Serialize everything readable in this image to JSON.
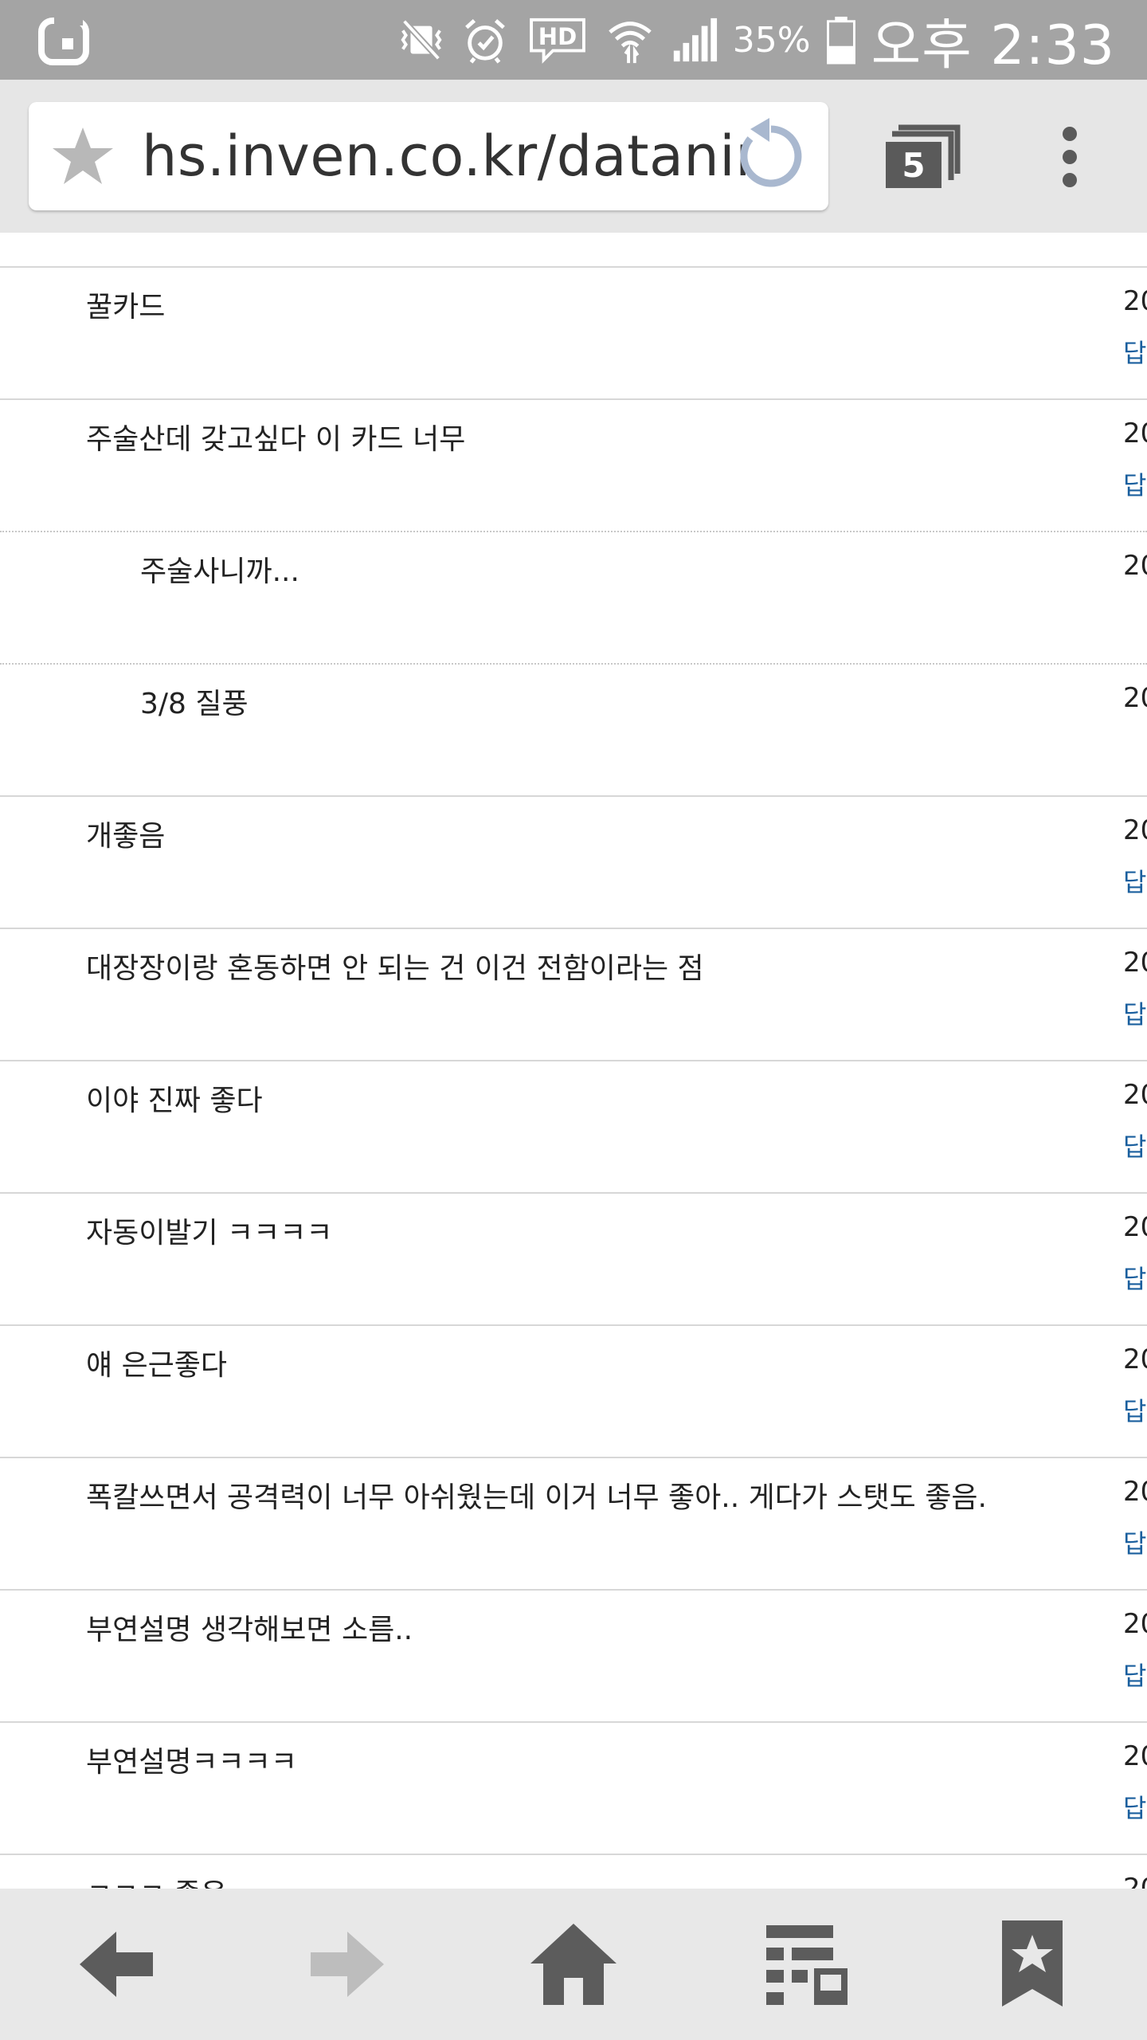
{
  "status_bar": {
    "icons": [
      "carrier-logo-icon",
      "vibrate-off-icon",
      "alarm-icon",
      "hd-voice-icon",
      "wifi-icon",
      "signal-icon",
      "battery-icon"
    ],
    "hd_label": "HD",
    "battery_percent": "35%",
    "time": "오후 2:33"
  },
  "toolbar": {
    "url": "hs.inven.co.kr/dataninfo",
    "tab_count": "5"
  },
  "list": [
    {
      "title": "꿀카드",
      "date": "20",
      "reply": "답",
      "indent": false,
      "sep": "solid"
    },
    {
      "title": "주술산데 갖고싶다 이 카드 너무",
      "date": "20",
      "reply": "답",
      "indent": false,
      "sep": "solid"
    },
    {
      "title": "주술사니까...",
      "date": "20",
      "reply": "",
      "indent": true,
      "sep": "dotted"
    },
    {
      "title": "3/8 질풍",
      "date": "20",
      "reply": "",
      "indent": true,
      "sep": "dotted"
    },
    {
      "title": "개좋음",
      "date": "20",
      "reply": "답",
      "indent": false,
      "sep": "solid"
    },
    {
      "title": "대장장이랑 혼동하면 안 되는 건 이건 전함이라는 점",
      "date": "20",
      "reply": "답",
      "indent": false,
      "sep": "solid"
    },
    {
      "title": "이야 진짜 좋다",
      "date": "20",
      "reply": "답",
      "indent": false,
      "sep": "solid"
    },
    {
      "title": "자동이발기 ㅋㅋㅋㅋ",
      "date": "20",
      "reply": "답",
      "indent": false,
      "sep": "solid"
    },
    {
      "title": "얘 은근좋다",
      "date": "20",
      "reply": "답",
      "indent": false,
      "sep": "solid"
    },
    {
      "title": "폭칼쓰면서 공격력이 너무 아쉬웠는데 이거 너무 좋아.. 게다가 스탯도 좋음.",
      "date": "20",
      "reply": "답",
      "indent": false,
      "sep": "solid"
    },
    {
      "title": "부연설명 생각해보면 소름..",
      "date": "20",
      "reply": "답",
      "indent": false,
      "sep": "solid"
    },
    {
      "title": "부연설명ㅋㅋㅋㅋ",
      "date": "20",
      "reply": "답",
      "indent": false,
      "sep": "solid"
    },
    {
      "title": "ㅋㅋㅋ 좋음",
      "date": "20",
      "reply": "",
      "indent": false,
      "sep": "solid"
    }
  ],
  "bottom_nav": {
    "items": [
      "back-icon",
      "forward-icon",
      "home-icon",
      "reading-list-icon",
      "bookmarks-icon"
    ]
  },
  "colors": {
    "status_bar_bg": "#a4a4a4",
    "toolbar_bg": "#e6e6e6",
    "reload_accent": "#a9b8cf",
    "reply_link": "#1a5f9e",
    "bottom_nav_bg": "#e8e8e8"
  }
}
